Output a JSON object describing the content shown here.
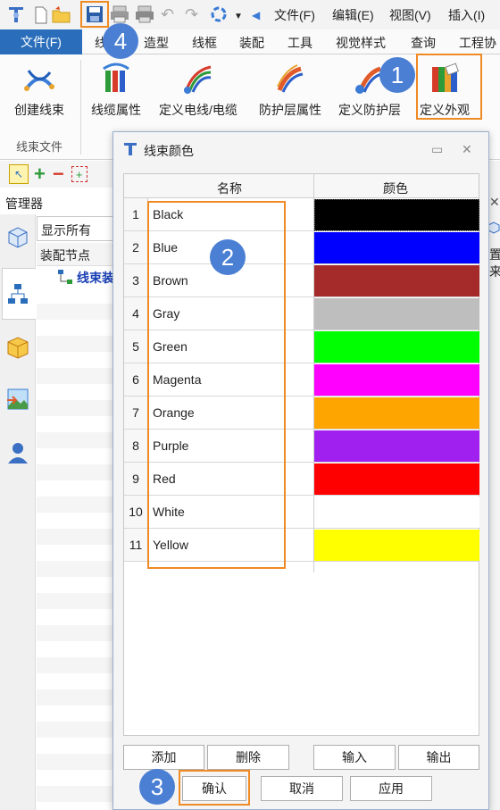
{
  "qat": {
    "menus": [
      "文件(F)",
      "编辑(E)",
      "视图(V)",
      "插入(I)"
    ]
  },
  "tabs": {
    "file": "文件(F)",
    "items": [
      "线",
      "造型",
      "线框",
      "装配",
      "工具",
      "视觉样式",
      "查询",
      "工程协"
    ]
  },
  "ribbon": {
    "buttons": [
      "创建线束",
      "线缆属性",
      "定义电线/电缆",
      "防护层属性",
      "定义防护层",
      "定义外观"
    ],
    "group_label": "线束文件"
  },
  "left_panel": {
    "manager": "管理器",
    "filter_value": "显示所有",
    "tree_header": "装配节点",
    "tree_node": "线束装"
  },
  "right_edge": {
    "chars": [
      "置",
      "来"
    ]
  },
  "dialog": {
    "title": "线束颜色",
    "col_name": "名称",
    "col_color": "颜色",
    "rows": [
      {
        "num": "1",
        "name": "Black",
        "color": "#000000"
      },
      {
        "num": "2",
        "name": "Blue",
        "color": "#0000ff"
      },
      {
        "num": "3",
        "name": "Brown",
        "color": "#a52a2a"
      },
      {
        "num": "4",
        "name": "Gray",
        "color": "#bebebe"
      },
      {
        "num": "5",
        "name": "Green",
        "color": "#00ff00"
      },
      {
        "num": "6",
        "name": "Magenta",
        "color": "#ff00ff"
      },
      {
        "num": "7",
        "name": "Orange",
        "color": "#ffa500"
      },
      {
        "num": "8",
        "name": "Purple",
        "color": "#a020f0"
      },
      {
        "num": "9",
        "name": "Red",
        "color": "#ff0000"
      },
      {
        "num": "10",
        "name": "White",
        "color": "#ffffff"
      },
      {
        "num": "11",
        "name": "Yellow",
        "color": "#ffff00"
      }
    ],
    "btn_add": "添加",
    "btn_delete": "删除",
    "btn_import": "输入",
    "btn_export": "输出",
    "btn_ok": "确认",
    "btn_cancel": "取消",
    "btn_apply": "应用"
  },
  "callouts": [
    "1",
    "2",
    "3",
    "4"
  ],
  "colors": {
    "accent_blue": "#2a6ebb",
    "highlight_orange": "#f08a24",
    "callout_blue": "#4a7fd4"
  }
}
